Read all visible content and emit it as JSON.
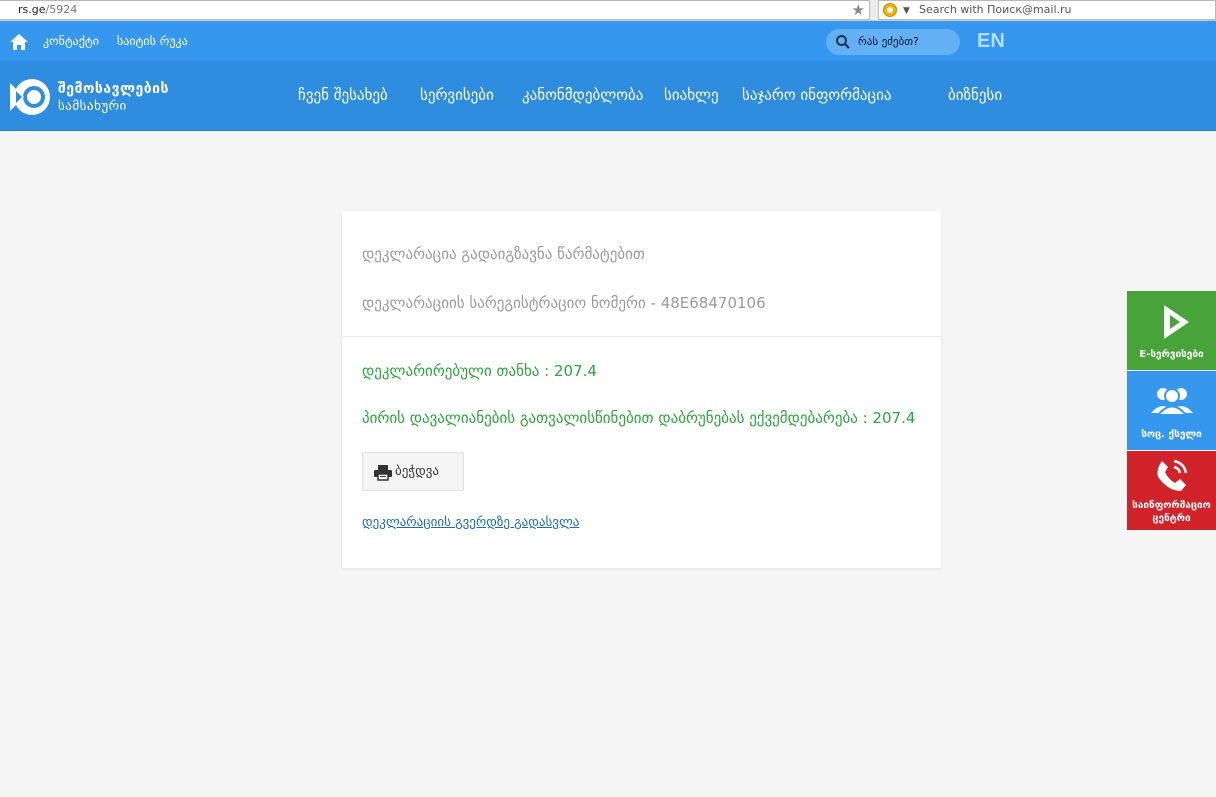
{
  "browser": {
    "url_host": "rs.ge",
    "url_path": "/5924",
    "search_placeholder": "Search with Поиск@mail.ru"
  },
  "topbar": {
    "links": [
      "კონტაქტი",
      "საიტის რუკა"
    ],
    "search_placeholder": "რას ეძებთ?",
    "language": "EN"
  },
  "logo": {
    "line1": "შემოსავლების",
    "line2": "სამსახური"
  },
  "nav": {
    "items": [
      "ჩვენ შესახებ",
      "სერვისები",
      "კანონმდებლობა",
      "სიახლე",
      "საჯარო ინფორმაცია",
      "ბიზნესი"
    ]
  },
  "card": {
    "title": "დეკლარაცია გადაიგზავნა წარმატებით",
    "registration": "დეკლარაციის სარეგისტრაციო ნომერი - 48E68470106",
    "declared": "დეკლარირებული თანხა : 207.4",
    "refund": "პირის დავალიანების გათვალისწინებით დაბრუნებას ექვემდებარება : 207.4",
    "print_label": "ბეჭდვა",
    "back_link": "დეკლარაციის გვერდზე გადასვლა"
  },
  "side": {
    "eservices": "E-სერვისები",
    "social": "სოც. ქსელი",
    "info_center_line1": "საინფორმაციო",
    "info_center_line2": "ცენტრი"
  },
  "colors": {
    "primary": "#3597ee",
    "nav": "#2f8de0",
    "success_text": "#2aa63a",
    "eservices": "#48a43a",
    "info_center": "#d2232a"
  }
}
